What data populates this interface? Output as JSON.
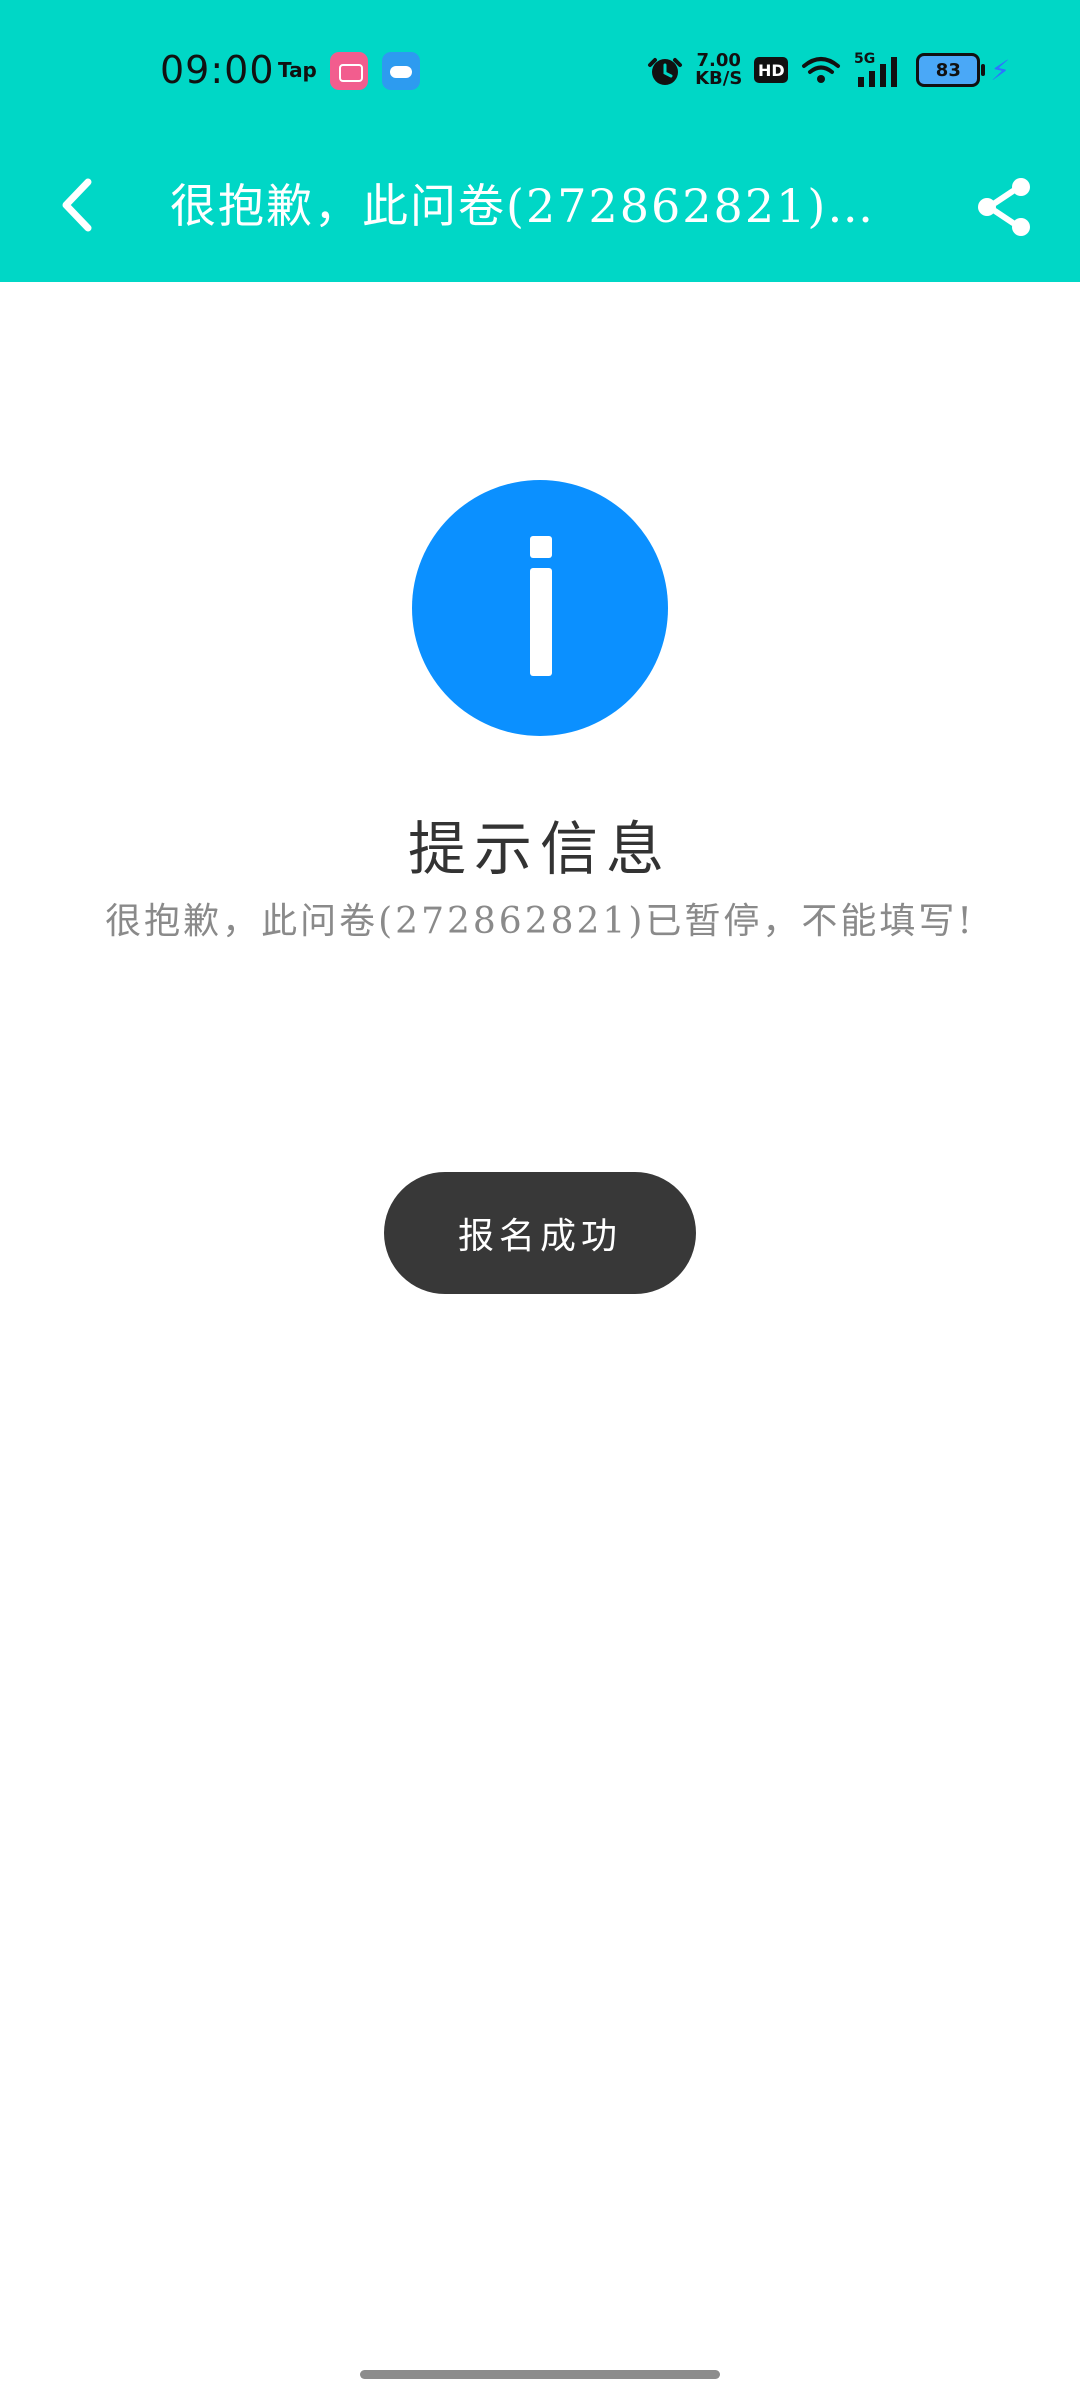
{
  "status_bar": {
    "time": "09:00",
    "app_tap": "Tap",
    "speed_value": "7.00",
    "speed_unit": "KB/S",
    "hd": "HD",
    "network": "5G",
    "battery": "83"
  },
  "nav": {
    "title": "很抱歉，此问卷(272862821)已…"
  },
  "main": {
    "prompt_title": "提示信息",
    "prompt_message": "很抱歉，此问卷(272862821)已暂停，不能填写!",
    "button_label": "报名成功"
  },
  "colors": {
    "header_bg": "#00d7c6",
    "info_blue": "#0b90ff",
    "button_bg": "#383838"
  }
}
